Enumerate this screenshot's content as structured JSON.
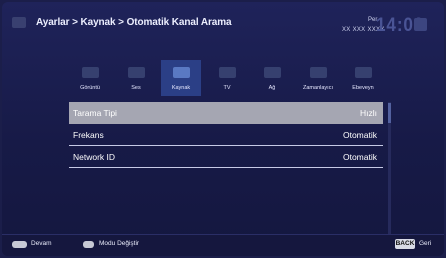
{
  "header": {
    "breadcrumb": "Ayarlar > Kaynak > Otomatik Kanal Arama",
    "day": "Per",
    "date": "XX XXX XXXX",
    "clock": "14:00"
  },
  "tabs": [
    {
      "label": "Görüntü",
      "icon": "picture-icon"
    },
    {
      "label": "Ses",
      "icon": "speaker-icon"
    },
    {
      "label": "Kaynak",
      "icon": "antenna-icon"
    },
    {
      "label": "TV",
      "icon": "tv-icon"
    },
    {
      "label": "Ağ",
      "icon": "network-icon"
    },
    {
      "label": "Zamanlayıcı",
      "icon": "timer-icon"
    },
    {
      "label": "Ebeveyn",
      "icon": "parental-icon"
    }
  ],
  "active_tab": "Kaynak",
  "settings": [
    {
      "label": "Tarama Tipi",
      "value": "Hızlı"
    },
    {
      "label": "Frekans",
      "value": "Otomatik"
    },
    {
      "label": "Network ID",
      "value": "Otomatik"
    }
  ],
  "footer": {
    "continue": "Devam",
    "mode_change": "Modu Değiştir",
    "back_key": "BACK",
    "back": "Geri"
  },
  "colors": {
    "background": "#1b1e4a",
    "active_tab": "#2b3f86",
    "selected_row": "#a5a6b2"
  }
}
